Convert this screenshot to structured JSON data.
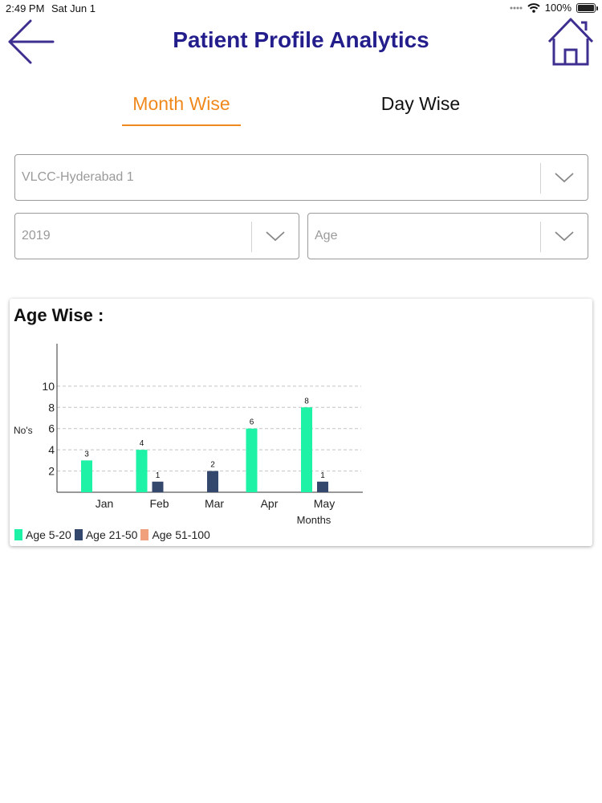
{
  "status_bar": {
    "time": "2:49 PM",
    "date": "Sat Jun 1",
    "battery": "100%"
  },
  "header": {
    "title": "Patient Profile Analytics",
    "back_icon": "arrow-left-icon",
    "home_icon": "home-icon",
    "icon_color": "#3d2f8f",
    "title_color": "#231e8c"
  },
  "tabs": [
    {
      "label": "Month Wise",
      "active": true
    },
    {
      "label": "Day Wise",
      "active": false
    }
  ],
  "filters": {
    "center": {
      "value": "VLCC-Hyderabad 1"
    },
    "year": {
      "value": "2019"
    },
    "category": {
      "value": "Age"
    }
  },
  "chart_card": {
    "title": "Age Wise :"
  },
  "chart_data": {
    "type": "bar",
    "categories": [
      "Jan",
      "Feb",
      "Mar",
      "Apr",
      "May"
    ],
    "series": [
      {
        "name": "Age 5-20",
        "color": "#1ef2a6",
        "values": [
          3,
          4,
          0,
          6,
          8
        ]
      },
      {
        "name": "Age 21-50",
        "color": "#34486e",
        "values": [
          0,
          1,
          2,
          0,
          1
        ]
      },
      {
        "name": "Age 51-100",
        "color": "#f0a07a",
        "values": [
          0,
          0,
          0,
          0,
          0
        ]
      }
    ],
    "ylabel": "No's",
    "xlabel": "Months",
    "yticks": [
      2,
      4,
      6,
      8,
      10
    ],
    "ylim": [
      0,
      14
    ],
    "grid": true,
    "grid_style": "dashed",
    "legend": "bottom-left"
  }
}
